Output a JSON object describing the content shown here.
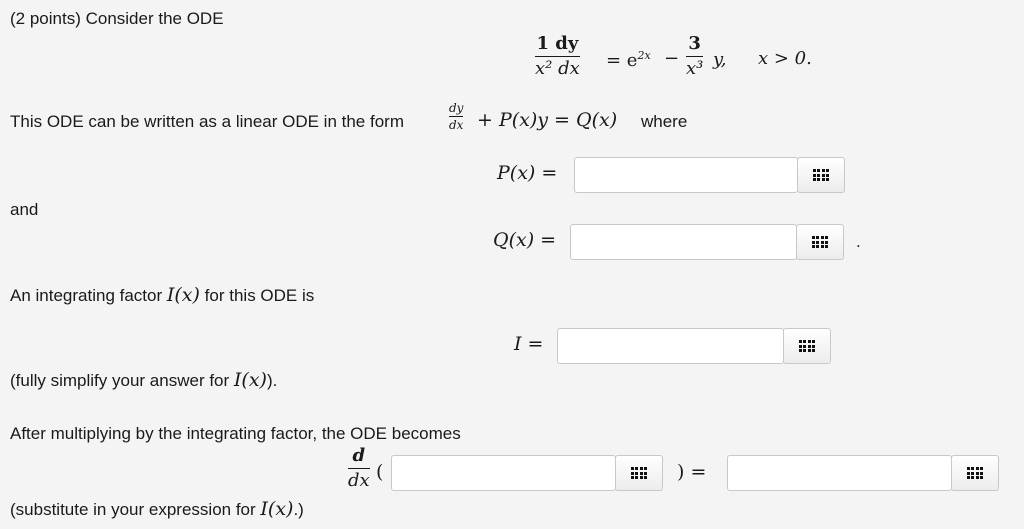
{
  "problem": {
    "header": "(2 points) Consider the ODE",
    "ode": {
      "lhs_num": "1 dy",
      "lhs_den": "x² dx",
      "equals_e": "= e",
      "exponent": "2x",
      "minus": "−",
      "coef_num": "3",
      "coef_den": "x³",
      "y_tail": "y,",
      "condition": "x > 0."
    },
    "linear_form_text": "This ODE can be written as a linear ODE in the form",
    "form_num": "dy",
    "form_den": "dx",
    "form_rest": "+ P(x)y = Q(x)",
    "form_where": "where",
    "p_label": "P(x) =",
    "and_text": "and",
    "q_label": "Q(x) =",
    "q_period": ".",
    "if_text_pre": "An integrating factor",
    "if_symbol": "I(x)",
    "if_text_post": "for this ODE is",
    "i_label": "I =",
    "simplify_pre": "(fully simplify your answer for",
    "simplify_symbol": "I(x)",
    "simplify_post": ").",
    "after_text": "After multiplying by the integrating factor, the ODE becomes",
    "d_num": "d",
    "d_den": "dx",
    "open_paren": "(",
    "close_eq": ") =",
    "substitute_pre": "(substitute in your expression for",
    "substitute_symbol": "I(x)",
    "substitute_post": ".)"
  },
  "inputs": {
    "p_value": "",
    "q_value": "",
    "i_value": "",
    "lhs_value": "",
    "rhs_value": ""
  },
  "icons": {
    "palette": "grid-icon"
  }
}
